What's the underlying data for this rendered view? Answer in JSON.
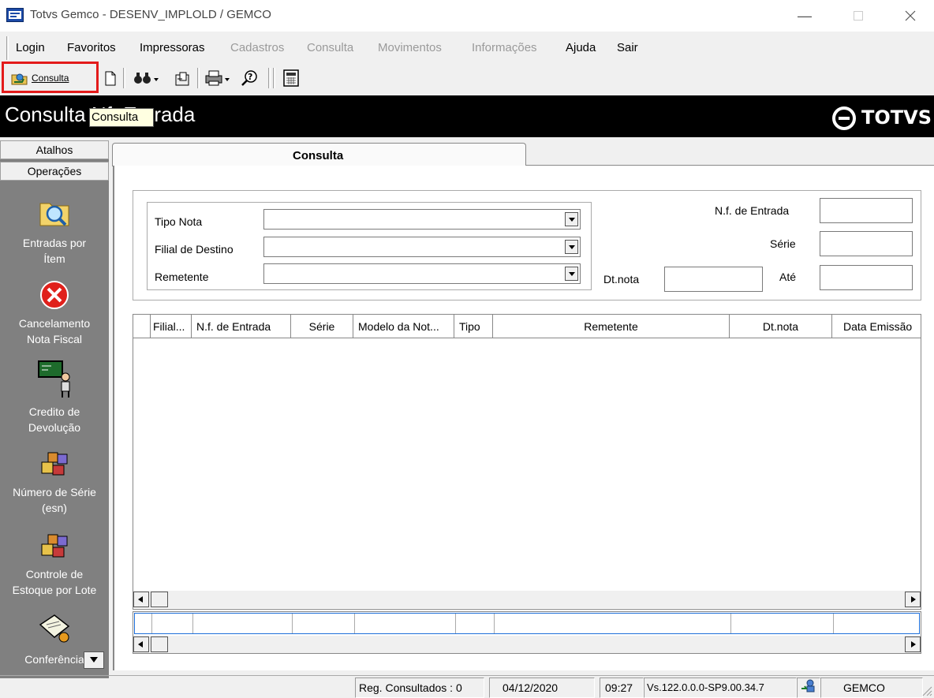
{
  "window": {
    "title": "Totvs Gemco - DESENV_IMPLOLD / GEMCO",
    "icon": "app-window-icon"
  },
  "menu": [
    {
      "label": "Login",
      "enabled": true
    },
    {
      "label": "Favoritos",
      "enabled": true
    },
    {
      "label": "Impressoras",
      "enabled": true
    },
    {
      "label": "Cadastros",
      "enabled": false
    },
    {
      "label": "Consulta",
      "enabled": false
    },
    {
      "label": "Movimentos",
      "enabled": false
    },
    {
      "label": "Informações",
      "enabled": false
    },
    {
      "label": "Ajuda",
      "enabled": true
    },
    {
      "label": "Sair",
      "enabled": true
    }
  ],
  "toolbar": {
    "consulta_label": "Consulta",
    "icons": [
      "consulta-icon",
      "new-document-icon",
      "binoculars-icon",
      "export-icon",
      "printer-icon",
      "help-search-icon",
      "calculator-icon"
    ]
  },
  "header": {
    "title": "Consulta Nf. Entrada",
    "brand": "TOTVS"
  },
  "tooltip": {
    "text": "Consulta"
  },
  "sidebar": {
    "sections": [
      "Atalhos",
      "Operações"
    ],
    "items": [
      {
        "line1": "Entradas por",
        "line2": "Ítem",
        "icon": "folder-search-icon"
      },
      {
        "line1": "Cancelamento",
        "line2": "Nota Fiscal",
        "icon": "cancel-x-icon"
      },
      {
        "line1": "Credito de",
        "line2": "Devolução",
        "icon": "teacher-board-icon"
      },
      {
        "line1": "Número de Série",
        "line2": "(esn)",
        "icon": "boxes-icon"
      },
      {
        "line1": "Controle de",
        "line2": "Estoque por Lote",
        "icon": "boxes-icon"
      },
      {
        "line1": "Conferência",
        "line2": "",
        "icon": "document-check-icon"
      }
    ]
  },
  "tab": {
    "label": "Consulta"
  },
  "filters": {
    "tipo_nota": {
      "label": "Tipo Nota",
      "value": ""
    },
    "filial_destino": {
      "label": "Filial de Destino",
      "value": ""
    },
    "remetente": {
      "label": "Remetente",
      "value": ""
    },
    "nf_entrada": {
      "label": "N.f. de Entrada",
      "value": ""
    },
    "serie": {
      "label": "Série",
      "value": ""
    },
    "dt_nota": {
      "label": "Dt.nota",
      "value": ""
    },
    "ate": {
      "label": "Até",
      "value": ""
    }
  },
  "grid": {
    "columns": [
      "Filial...",
      "N.f. de Entrada",
      "Série",
      "Modelo da Not...",
      "Tipo",
      "Remetente",
      "Dt.nota",
      "Data Emissão"
    ],
    "rows": []
  },
  "status": {
    "reg": "Reg. Consultados : 0",
    "date": "04/12/2020",
    "time": "09:27",
    "version": "Vs.122.0.0.0-SP9.00.34.7",
    "user_icon": "user-network-icon",
    "user": "GEMCO"
  }
}
